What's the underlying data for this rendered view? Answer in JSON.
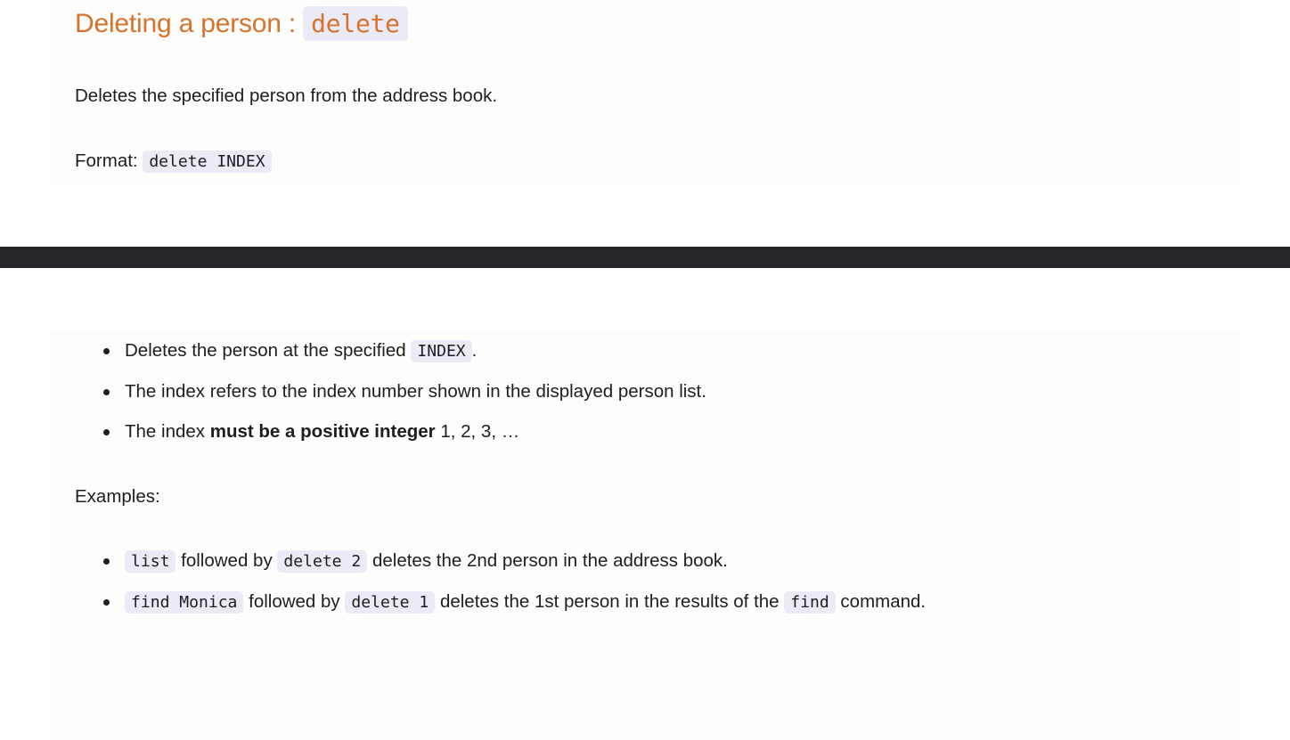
{
  "colors": {
    "heading_orange": "#d9722b",
    "body_text": "#1c1e21",
    "code_background": "#ebeaf7",
    "panel_background": "#fdfdfc",
    "separator_band": "#26262a",
    "page_background": "#ffffff"
  },
  "section": {
    "heading_prefix": "Deleting a person :",
    "heading_code": "delete",
    "description": "Deletes the specified person from the address book.",
    "format_label": "Format:",
    "format_code": "delete INDEX"
  },
  "notes": {
    "items": [
      {
        "before": "Deletes the person at the specified",
        "code": "INDEX",
        "after": "."
      },
      {
        "before": "The index refers to the index number shown in the displayed person list.",
        "code": "",
        "after": ""
      },
      {
        "before": "The index",
        "bold": "must be a positive integer",
        "after": "1, 2, 3, …"
      }
    ]
  },
  "examples": {
    "label": "Examples:",
    "items": [
      {
        "code1": "list",
        "mid": "followed by",
        "code2": "delete 2",
        "after": "deletes the 2nd person in the address book."
      },
      {
        "code1": "find Monica",
        "mid": "followed by",
        "code2": "delete 1",
        "after": "deletes the 1st person in the results of the",
        "code3": "find",
        "tail": "command."
      }
    ]
  }
}
